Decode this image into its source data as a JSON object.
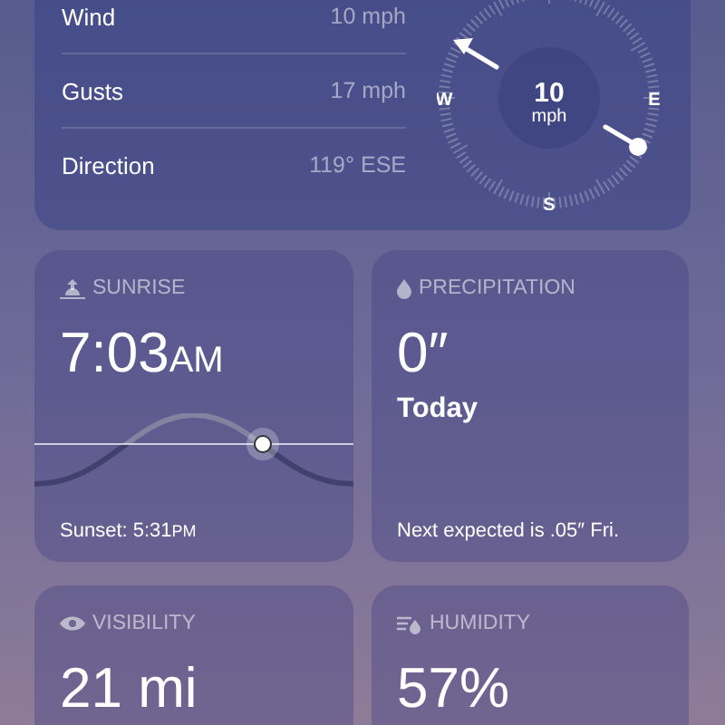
{
  "wind": {
    "rows": [
      {
        "label": "Wind",
        "value": "10 mph"
      },
      {
        "label": "Gusts",
        "value": "17 mph"
      },
      {
        "label": "Direction",
        "value": "119° ESE"
      }
    ],
    "compass": {
      "speed": "10",
      "unit": "mph",
      "points": [
        "W",
        "E",
        "S"
      ]
    }
  },
  "sunrise": {
    "title": "SUNRISE",
    "time": "7:03",
    "time_suffix": "AM",
    "sunset_label": "Sunset: 5:31",
    "sunset_suffix": "PM"
  },
  "precipitation": {
    "title": "PRECIPITATION",
    "amount": "0″",
    "period": "Today",
    "note": "Next expected is .05″ Fri."
  },
  "visibility": {
    "title": "VISIBILITY",
    "value": "21 mi"
  },
  "humidity": {
    "title": "HUMIDITY",
    "value": "57%"
  }
}
